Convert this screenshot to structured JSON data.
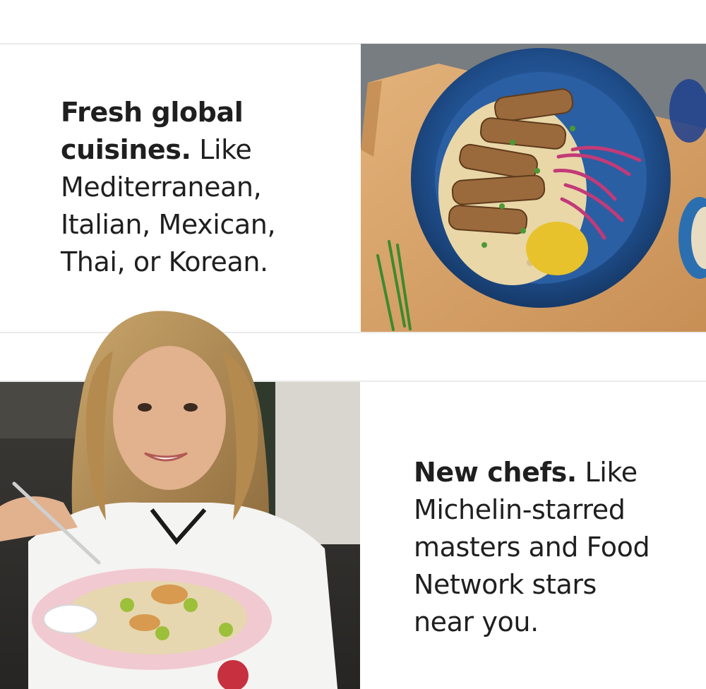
{
  "sections": [
    {
      "lead": "Fresh global",
      "lead_cont": "cuisines.",
      "body_1": " Like",
      "body_2": "Mediterranean,",
      "body_3": "Italian, Mexican,",
      "body_4": "Thai, or Korean.",
      "image": "food-bowl-photo"
    },
    {
      "lead": "New chefs.",
      "body_1": " Like",
      "body_2": "Michelin-starred",
      "body_3": "masters and Food",
      "body_4": "Network stars",
      "body_5": "near you.",
      "image": "chef-portrait-photo"
    }
  ],
  "colors": {
    "text": "#1f1f1f",
    "divider": "#ebebeb",
    "plate_blue": "#1f4e8c",
    "cutting_board": "#d9a56a",
    "chef_coat": "#f4f4f2"
  }
}
